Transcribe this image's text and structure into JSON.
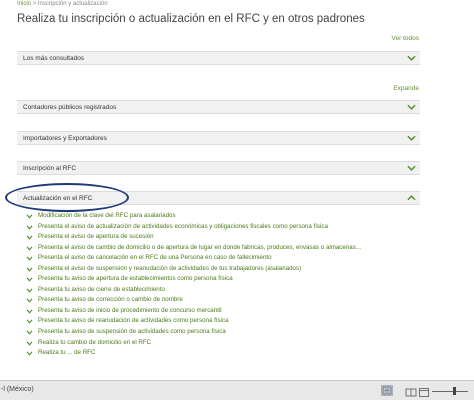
{
  "breadcrumb": {
    "home": "Inicio",
    "separator": ">",
    "current": "Inscripción y actualización"
  },
  "page_title": "Realiza tu inscripción o actualización en el RFC y en otros padrones",
  "links": {
    "ver_todos": "Ver todos",
    "expande": "Expande"
  },
  "sections": {
    "mas_consultados": "Los más consultados",
    "contadores": "Contadores públicos registrados",
    "importadores": "Importadores y Exportadores",
    "inscripcion": "Inscripción al RFC",
    "actualizacion": "Actualización en el RFC"
  },
  "actualizacion_items": [
    "Modificación de la clave del RFC para asalariados",
    "Presenta el aviso de actualización de actividades económicas y obligaciones fiscales como persona física",
    "Presenta el aviso de apertura de sucesión",
    "Presenta el aviso de cambio de domicilio o de apertura de lugar en donde fabricas, produces, envasas o almacenas...",
    "Presenta el aviso de cancelación en el RFC de una Persona en caso de fallecimiento",
    "Presenta el aviso de suspensión y reanudación de actividades de tus trabajadores (asalariados)",
    "Presenta tu aviso de apertura de establecimientos como persona física",
    "Presenta tu aviso de cierre de establecimiento",
    "Presenta tu aviso de corrección o cambio de nombre",
    "Presenta tu aviso de inicio de procedimiento de concurso mercantil",
    "Presenta tu aviso de reanudación de actividades como persona física",
    "Presenta tu aviso de suspensión de actividades como persona física",
    "Realiza tu cambio de domicilio en el RFC",
    "Realiza tu ... de RFC"
  ],
  "taskbar": {
    "locale_text": "-l (México)"
  },
  "colors": {
    "accent_green": "#6a8f3a",
    "oval_blue": "#1e3a78"
  }
}
